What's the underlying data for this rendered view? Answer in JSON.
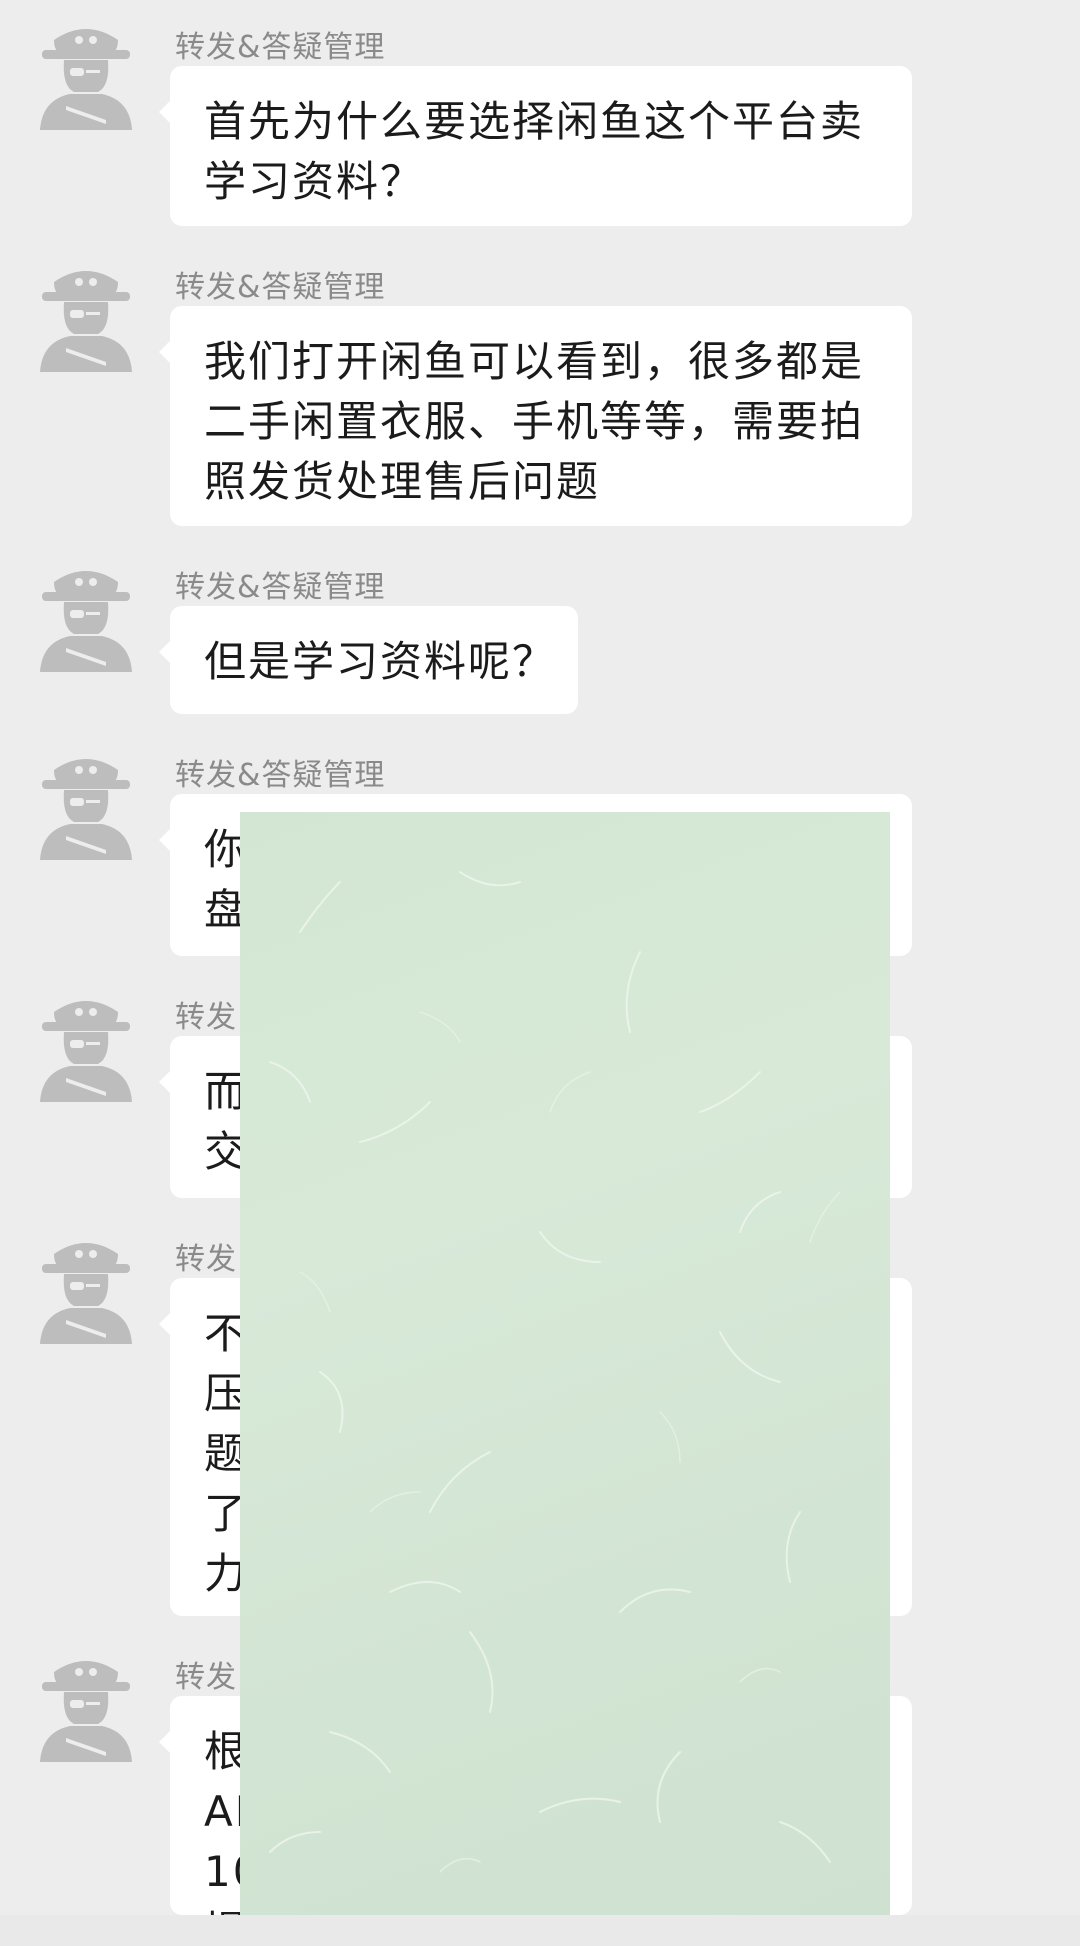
{
  "messages": [
    {
      "sender": "转发&答疑管理",
      "lines": [
        "首先为什么要选择闲鱼这个平台卖",
        "学习资料？"
      ]
    },
    {
      "sender": "转发&答疑管理",
      "lines": [
        "我们打开闲鱼可以看到，很多都是",
        "二手闲置衣服、手机等等，需要拍",
        "照发货处理售后问题"
      ]
    },
    {
      "sender": "转发&答疑管理",
      "lines": [
        "但是学习资料呢？"
      ]
    },
    {
      "sender": "转发&答疑管理",
      "lines": [
        "你",
        "盘"
      ]
    },
    {
      "sender": "转发",
      "lines": [
        "而",
        "交"
      ]
    },
    {
      "sender": "转发",
      "lines": [
        "不",
        "压",
        "题",
        "了",
        "力"
      ]
    },
    {
      "sender": "转发",
      "lines": [
        "根",
        "AI",
        "10",
        "提"
      ]
    }
  ],
  "overlay": {
    "icon": "paper-texture-overlay",
    "color": "#d5e7d5"
  },
  "colors": {
    "background": "#ededed",
    "bubble": "#ffffff",
    "sender": "#8a8a8a"
  }
}
